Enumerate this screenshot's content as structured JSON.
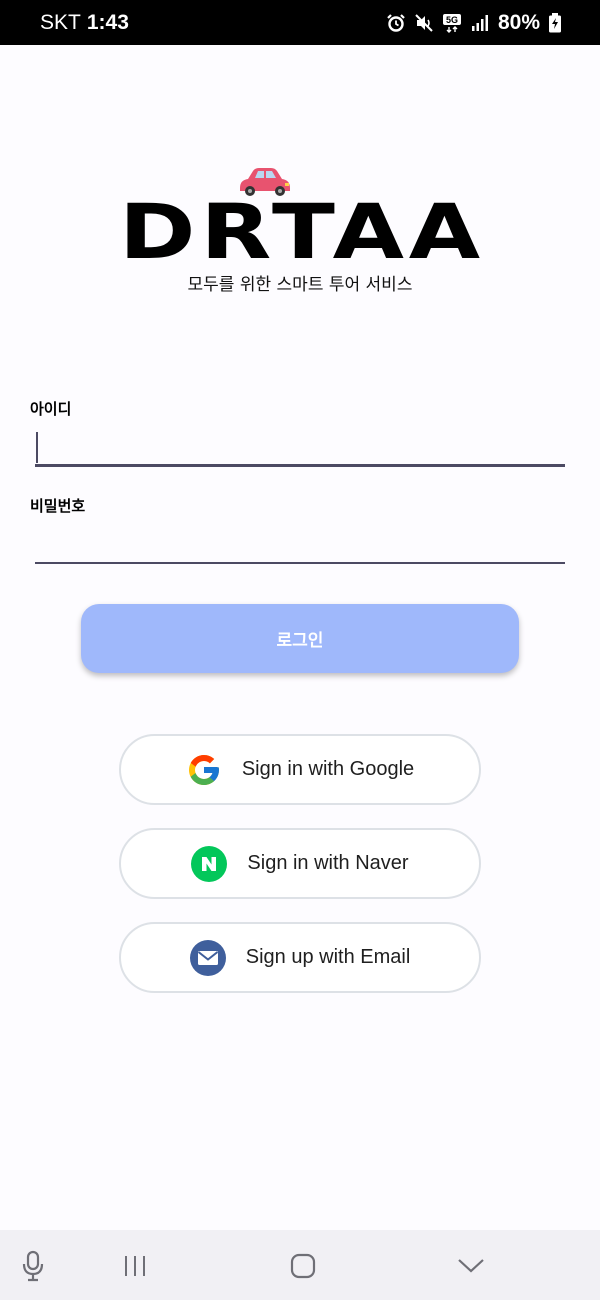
{
  "status_bar": {
    "carrier": "SKT",
    "time": "1:43",
    "network": "5G",
    "battery": "80%",
    "icons": [
      "alarm-icon",
      "mute-icon",
      "5g-icon",
      "signal-icon",
      "battery-icon"
    ]
  },
  "brand": {
    "logo": "DRTAA",
    "tagline": "모두를 위한 스마트 투어 서비스"
  },
  "form": {
    "id_label": "아이디",
    "id_value": "",
    "password_label": "비밀번호",
    "password_value": "",
    "login_label": "로그인",
    "login_color": "#9fb8fb"
  },
  "social": {
    "google_label": "Sign in with Google",
    "naver_label": "Sign in with Naver",
    "email_label": "Sign up with Email"
  },
  "colors": {
    "naver_green": "#03c75a",
    "email_blue": "#3f5f9c",
    "underline": "#4c4a63"
  },
  "nav_bar": {
    "items": [
      "mic-icon",
      "recent-apps-icon",
      "home-icon",
      "hide-keyboard-icon"
    ]
  }
}
